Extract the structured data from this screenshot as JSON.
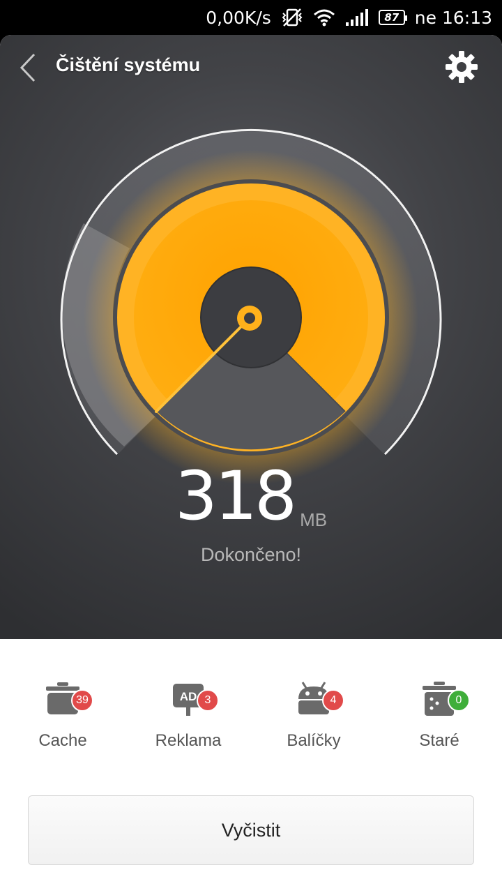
{
  "status_bar": {
    "network_speed": "0,00K/s",
    "battery": "87",
    "time": "ne 16:13",
    "icons": [
      "vibrate-off-icon",
      "wifi-icon",
      "signal-icon",
      "battery-icon"
    ]
  },
  "header": {
    "title": "Čištění systému",
    "back_icon": "back-chevron-icon",
    "settings_icon": "gear-icon"
  },
  "gauge": {
    "value": "318",
    "unit": "MB",
    "status": "Dokončeno!",
    "colors": {
      "accent": "#ffad0f",
      "background": "#3a3b3f"
    }
  },
  "categories": [
    {
      "label": "Cache",
      "count": "39",
      "icon": "cache-pot-icon",
      "badge_color": "#e14a4a"
    },
    {
      "label": "Reklama",
      "count": "3",
      "icon": "ad-icon",
      "badge_color": "#e14a4a"
    },
    {
      "label": "Balíčky",
      "count": "4",
      "icon": "android-icon",
      "badge_color": "#e14a4a"
    },
    {
      "label": "Staré",
      "count": "0",
      "icon": "trash-icon",
      "badge_color": "#3fae3a"
    }
  ],
  "actions": {
    "clean_label": "Vyčistit"
  }
}
